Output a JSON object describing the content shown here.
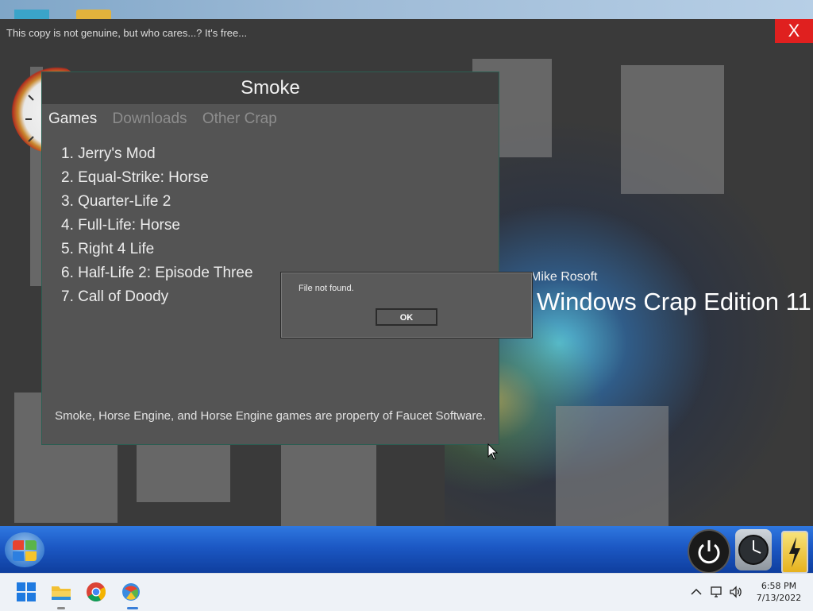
{
  "fake_os": {
    "watermark": "This copy is not genuine, but who cares...? It's free...",
    "close_label": "X",
    "brand_small": "Mike Rosoft",
    "brand_big": "Windows Crap Edition 11"
  },
  "smoke": {
    "title": "Smoke",
    "tabs": [
      {
        "label": "Games",
        "active": true
      },
      {
        "label": "Downloads",
        "active": false
      },
      {
        "label": "Other Crap",
        "active": false
      }
    ],
    "games": [
      "1. Jerry's Mod",
      "2. Equal-Strike: Horse",
      "3. Quarter-Life 2",
      "4. Full-Life: Horse",
      "5. Right 4 Life",
      "6. Half-Life 2: Episode Three",
      "7. Call of Doody"
    ],
    "footer": "Smoke, Horse Engine, and Horse Engine games are property of Faucet Software."
  },
  "dialog": {
    "message": "File not found.",
    "ok_label": "OK"
  },
  "taskbar": {
    "pinned": [
      "start-icon",
      "file-explorer-icon",
      "chrome-icon",
      "fake-os-app-icon"
    ],
    "time": "6:58 PM",
    "date": "7/13/2022",
    "tray_icons": [
      "chevron-up-icon",
      "network-icon",
      "volume-icon"
    ]
  },
  "colors": {
    "close_red": "#e0201f",
    "taskbar_blue": "#1c58c4"
  }
}
